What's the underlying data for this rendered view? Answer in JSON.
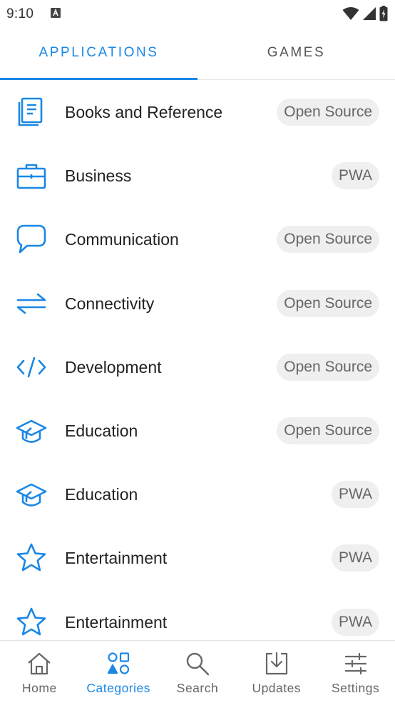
{
  "status_bar": {
    "time": "9:10"
  },
  "tabs": [
    {
      "label": "APPLICATIONS"
    },
    {
      "label": "GAMES"
    }
  ],
  "categories": [
    {
      "label": "Books and Reference",
      "chip": "Open Source",
      "icon": "book-icon"
    },
    {
      "label": "Business",
      "chip": "PWA",
      "icon": "briefcase-icon"
    },
    {
      "label": "Communication",
      "chip": "Open Source",
      "icon": "chat-bubble-icon"
    },
    {
      "label": "Connectivity",
      "chip": "Open Source",
      "icon": "swap-arrows-icon"
    },
    {
      "label": "Development",
      "chip": "Open Source",
      "icon": "code-icon"
    },
    {
      "label": "Education",
      "chip": "Open Source",
      "icon": "graduation-cap-icon"
    },
    {
      "label": "Education",
      "chip": "PWA",
      "icon": "graduation-cap-icon"
    },
    {
      "label": "Entertainment",
      "chip": "PWA",
      "icon": "star-icon"
    },
    {
      "label": "Entertainment",
      "chip": "PWA",
      "icon": "star-icon"
    }
  ],
  "bottom_nav": [
    {
      "label": "Home",
      "icon": "home-icon"
    },
    {
      "label": "Categories",
      "icon": "categories-icon"
    },
    {
      "label": "Search",
      "icon": "search-icon"
    },
    {
      "label": "Updates",
      "icon": "download-tray-icon"
    },
    {
      "label": "Settings",
      "icon": "sliders-icon"
    }
  ],
  "colors": {
    "accent": "#1a87e6",
    "chip_bg": "#efefef",
    "text": "#222222",
    "muted": "#666666"
  }
}
